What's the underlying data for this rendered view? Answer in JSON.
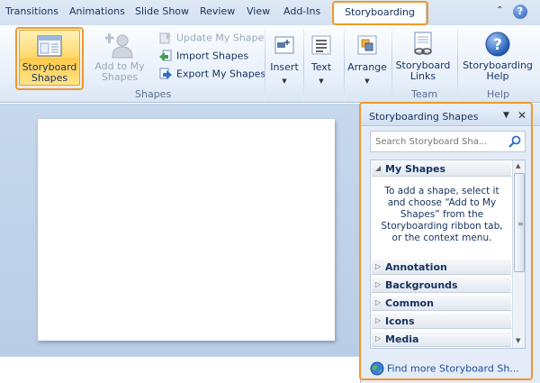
{
  "tabs": [
    {
      "label": "Transitions"
    },
    {
      "label": "Animations"
    },
    {
      "label": "Slide Show"
    },
    {
      "label": "Review"
    },
    {
      "label": "View"
    },
    {
      "label": "Add-Ins"
    }
  ],
  "active_tab": "Storyboarding",
  "ribbon": {
    "storyboard_shapes": "Storyboard Shapes",
    "add_to_my_shapes": "Add to My Shapes",
    "update_my_shape": "Update My Shape",
    "import_shapes": "Import Shapes",
    "export_my_shapes": "Export My Shapes",
    "shapes_group": "Shapes",
    "insert": "Insert",
    "text": "Text",
    "arrange": "Arrange",
    "storyboard_links": "Storyboard Links",
    "team_group": "Team",
    "storyboarding_help": "Storyboarding Help",
    "help_group": "Help"
  },
  "pane": {
    "title": "Storyboarding Shapes",
    "search_placeholder": "Search Storyboard Sha...",
    "my_shapes": "My Shapes",
    "info": "To add a shape, select it and choose “Add to My Shapes” from the Storyboarding ribbon tab, or the context menu.",
    "sections": [
      {
        "label": "Annotation"
      },
      {
        "label": "Backgrounds"
      },
      {
        "label": "Common"
      },
      {
        "label": "Icons"
      },
      {
        "label": "Media"
      }
    ],
    "find_more": "Find more Storyboard Sh..."
  },
  "colors": {
    "highlight": "#f0992b",
    "ribbon_selected": "#ffd86a",
    "link": "#1f4fa0"
  }
}
